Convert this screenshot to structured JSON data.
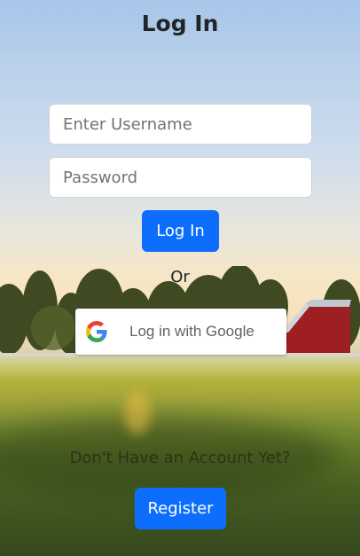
{
  "header": {
    "title": "Log In"
  },
  "form": {
    "username_placeholder": "Enter Username",
    "password_placeholder": "Password",
    "login_label": "Log In"
  },
  "divider": {
    "text": "Or"
  },
  "google": {
    "label": "Log in with Google",
    "icon": "google-g-logo"
  },
  "register": {
    "prompt": "Don't Have an Account Yet?",
    "button_label": "Register"
  },
  "colors": {
    "primary": "#0d6efd",
    "text": "#212529"
  }
}
